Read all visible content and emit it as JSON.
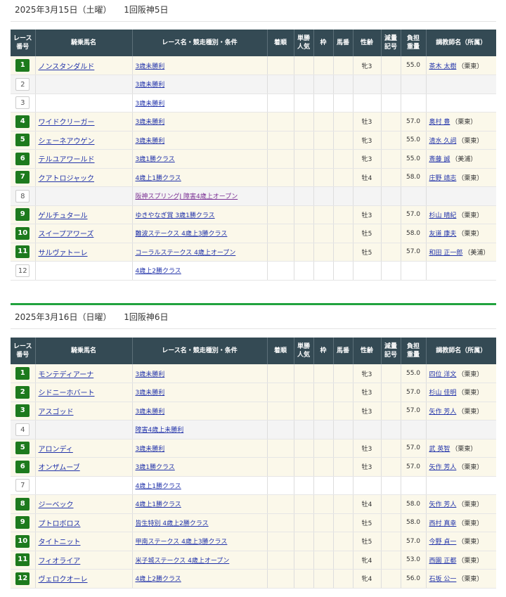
{
  "headers": [
    "レース\n番号",
    "騎乗馬名",
    "レース名・競走種別・条件",
    "着順",
    "単勝\n人気",
    "枠",
    "馬番",
    "性齢",
    "減量\n記号",
    "負担\n重量",
    "調教師名（所属）"
  ],
  "days": [
    {
      "date": "2025年3月15日（土曜）",
      "meeting": "1回阪神5日",
      "rows": [
        {
          "no": "1",
          "horse": "ノンスタンダルド",
          "race": "3歳未勝利",
          "sex_age": "牝3",
          "weight": "55.0",
          "trainer": "茶木 太樹",
          "affil": "（栗東）"
        },
        {
          "no": "2",
          "horse": "",
          "race": "3歳未勝利",
          "sex_age": "",
          "weight": "",
          "trainer": "",
          "affil": ""
        },
        {
          "no": "3",
          "horse": "",
          "race": "3歳未勝利",
          "sex_age": "",
          "weight": "",
          "trainer": "",
          "affil": ""
        },
        {
          "no": "4",
          "horse": "ワイドクリーガー",
          "race": "3歳未勝利",
          "sex_age": "牡3",
          "weight": "57.0",
          "trainer": "奥村 豊",
          "affil": "（栗東）"
        },
        {
          "no": "5",
          "horse": "シェーネアウゲン",
          "race": "3歳未勝利",
          "sex_age": "牝3",
          "weight": "55.0",
          "trainer": "清水 久詞",
          "affil": "（栗東）"
        },
        {
          "no": "6",
          "horse": "テルユアワールド",
          "race": "3歳1勝クラス",
          "sex_age": "牝3",
          "weight": "55.0",
          "trainer": "斎藤 誠",
          "affil": "（美浦）"
        },
        {
          "no": "7",
          "horse": "クアトロジャック",
          "race": "4歳上1勝クラス",
          "sex_age": "牡4",
          "weight": "58.0",
          "trainer": "庄野 靖志",
          "affil": "（栗東）"
        },
        {
          "no": "8",
          "horse": "",
          "race": "阪神スプリングJ 障害4歳上オープン",
          "sex_age": "",
          "weight": "",
          "trainer": "",
          "affil": ""
        },
        {
          "no": "9",
          "horse": "ゲルチュタール",
          "race": "ゆきやなぎ賞 3歳1勝クラス",
          "sex_age": "牡3",
          "weight": "57.0",
          "trainer": "杉山 晴紀",
          "affil": "（栗東）"
        },
        {
          "no": "10",
          "horse": "スイープアワーズ",
          "race": "難波ステークス 4歳上3勝クラス",
          "sex_age": "牡5",
          "weight": "58.0",
          "trainer": "友道 康夫",
          "affil": "（栗東）"
        },
        {
          "no": "11",
          "horse": "サルヴァトーレ",
          "race": "コーラルステークス 4歳上オープン",
          "sex_age": "牡5",
          "weight": "57.0",
          "trainer": "和田 正一郎",
          "affil": "（美浦）"
        },
        {
          "no": "12",
          "horse": "",
          "race": "4歳上2勝クラス",
          "sex_age": "",
          "weight": "",
          "trainer": "",
          "affil": ""
        }
      ]
    },
    {
      "date": "2025年3月16日（日曜）",
      "meeting": "1回阪神6日",
      "rows": [
        {
          "no": "1",
          "horse": "モンテディアーナ",
          "race": "3歳未勝利",
          "sex_age": "牝3",
          "weight": "55.0",
          "trainer": "四位 洋文",
          "affil": "（栗東）"
        },
        {
          "no": "2",
          "horse": "シドニーホバート",
          "race": "3歳未勝利",
          "sex_age": "牡3",
          "weight": "57.0",
          "trainer": "杉山 佳明",
          "affil": "（栗東）"
        },
        {
          "no": "3",
          "horse": "アスゴッド",
          "race": "3歳未勝利",
          "sex_age": "牡3",
          "weight": "57.0",
          "trainer": "矢作 芳人",
          "affil": "（栗東）"
        },
        {
          "no": "4",
          "horse": "",
          "race": "障害4歳上未勝利",
          "sex_age": "",
          "weight": "",
          "trainer": "",
          "affil": ""
        },
        {
          "no": "5",
          "horse": "アロンディ",
          "race": "3歳未勝利",
          "sex_age": "牡3",
          "weight": "57.0",
          "trainer": "武 英智",
          "affil": "（栗東）"
        },
        {
          "no": "6",
          "horse": "オンザムーブ",
          "race": "3歳1勝クラス",
          "sex_age": "牡3",
          "weight": "57.0",
          "trainer": "矢作 芳人",
          "affil": "（栗東）"
        },
        {
          "no": "7",
          "horse": "",
          "race": "4歳上1勝クラス",
          "sex_age": "",
          "weight": "",
          "trainer": "",
          "affil": ""
        },
        {
          "no": "8",
          "horse": "ジーベック",
          "race": "4歳上1勝クラス",
          "sex_age": "牡4",
          "weight": "58.0",
          "trainer": "矢作 芳人",
          "affil": "（栗東）"
        },
        {
          "no": "9",
          "horse": "プトロボロス",
          "race": "皆生特別 4歳上2勝クラス",
          "sex_age": "牡5",
          "weight": "58.0",
          "trainer": "西村 真幸",
          "affil": "（栗東）"
        },
        {
          "no": "10",
          "horse": "タイトニット",
          "race": "甲南ステークス 4歳上3勝クラス",
          "sex_age": "牡5",
          "weight": "57.0",
          "trainer": "今野 貞一",
          "affil": "（栗東）"
        },
        {
          "no": "11",
          "horse": "フィオライア",
          "race": "米子城ステークス 4歳上オープン",
          "sex_age": "牝4",
          "weight": "53.0",
          "trainer": "西園 正都",
          "affil": "（栗東）"
        },
        {
          "no": "12",
          "horse": "ヴェロクオーレ",
          "race": "4歳上2勝クラス",
          "sex_age": "牝4",
          "weight": "56.0",
          "trainer": "石坂 公一",
          "affil": "（栗東）"
        }
      ]
    }
  ],
  "colors": {
    "accent_green": "#21a33e",
    "race_no_green": "#1d7a1d",
    "header_bg": "#344a54",
    "row_ride_bg": "#fbf8ea"
  },
  "visited_race": "阪神スプリングJ 障害4歳上オープン"
}
